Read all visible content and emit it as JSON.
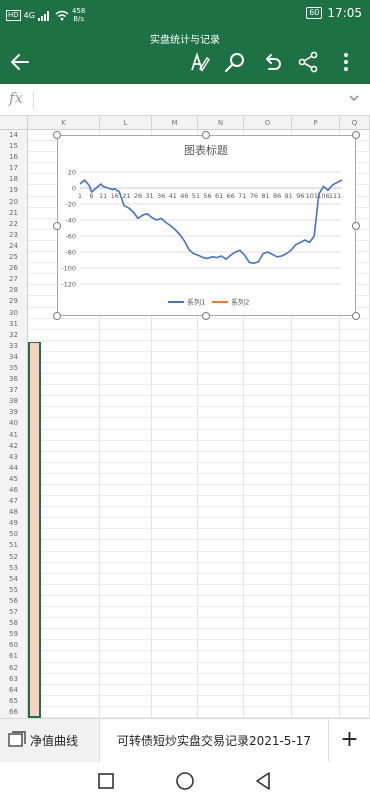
{
  "status": {
    "signal": "4G",
    "net_speed": "458",
    "net_unit": "B/s",
    "battery": "60",
    "time": "17:05"
  },
  "app": {
    "title": "实盘统计与记录",
    "icons": [
      "back-arrow-icon",
      "draw-pen-icon",
      "search-icon",
      "undo-icon",
      "share-icon",
      "more-vert-icon"
    ]
  },
  "formula_bar": {
    "fx_label": "fx",
    "value": ""
  },
  "columns": [
    "K",
    "L",
    "M",
    "N",
    "O",
    "P",
    "Q"
  ],
  "row_start": 14,
  "row_end": 66,
  "chart_data": {
    "type": "line",
    "title": "图表标题",
    "x": [
      1,
      6,
      11,
      16,
      21,
      26,
      31,
      36,
      41,
      46,
      51,
      56,
      61,
      66,
      71,
      76,
      81,
      86,
      91,
      96,
      101,
      106,
      111
    ],
    "x_tick_labels": [
      "1",
      "6",
      "11",
      "16",
      "21",
      "26",
      "31",
      "36",
      "41",
      "46",
      "51",
      "56",
      "61",
      "66",
      "71",
      "76",
      "81",
      "86",
      "91",
      "96",
      "101",
      "106",
      "111"
    ],
    "ylim": [
      -120,
      20
    ],
    "y_ticks": [
      20,
      0,
      -20,
      -40,
      -60,
      -80,
      -100,
      -120
    ],
    "grid": true,
    "legend_position": "bottom",
    "series": [
      {
        "name": "系列1",
        "color": "#4472c4",
        "points": [
          [
            1,
            5
          ],
          [
            3,
            10
          ],
          [
            5,
            3
          ],
          [
            6,
            -5
          ],
          [
            8,
            0
          ],
          [
            10,
            5
          ],
          [
            11,
            2
          ],
          [
            13,
            0
          ],
          [
            15,
            -2
          ],
          [
            16,
            -1
          ],
          [
            18,
            -5
          ],
          [
            20,
            -22
          ],
          [
            22,
            -25
          ],
          [
            24,
            -30
          ],
          [
            26,
            -38
          ],
          [
            28,
            -34
          ],
          [
            30,
            -32
          ],
          [
            32,
            -37
          ],
          [
            34,
            -40
          ],
          [
            36,
            -38
          ],
          [
            38,
            -43
          ],
          [
            40,
            -47
          ],
          [
            42,
            -52
          ],
          [
            44,
            -58
          ],
          [
            46,
            -66
          ],
          [
            48,
            -77
          ],
          [
            50,
            -82
          ],
          [
            52,
            -84
          ],
          [
            54,
            -87
          ],
          [
            56,
            -88
          ],
          [
            58,
            -86
          ],
          [
            60,
            -87
          ],
          [
            62,
            -85
          ],
          [
            64,
            -89
          ],
          [
            66,
            -84
          ],
          [
            68,
            -80
          ],
          [
            70,
            -78
          ],
          [
            72,
            -84
          ],
          [
            74,
            -93
          ],
          [
            76,
            -94
          ],
          [
            78,
            -92
          ],
          [
            80,
            -82
          ],
          [
            82,
            -80
          ],
          [
            84,
            -83
          ],
          [
            86,
            -86
          ],
          [
            88,
            -85
          ],
          [
            90,
            -82
          ],
          [
            92,
            -78
          ],
          [
            94,
            -71
          ],
          [
            96,
            -68
          ],
          [
            98,
            -65
          ],
          [
            100,
            -68
          ],
          [
            102,
            -60
          ],
          [
            104,
            -8
          ],
          [
            106,
            2
          ],
          [
            108,
            -3
          ],
          [
            110,
            4
          ],
          [
            114,
            10
          ]
        ]
      },
      {
        "name": "系列2",
        "color": "#ed7d31",
        "points": []
      }
    ]
  },
  "tabs": {
    "first": "净值曲线",
    "active": "可转债短炒实盘交易记录2021-5-17",
    "add": "+"
  },
  "nav": [
    "recents-square-icon",
    "home-circle-icon",
    "back-triangle-icon"
  ]
}
